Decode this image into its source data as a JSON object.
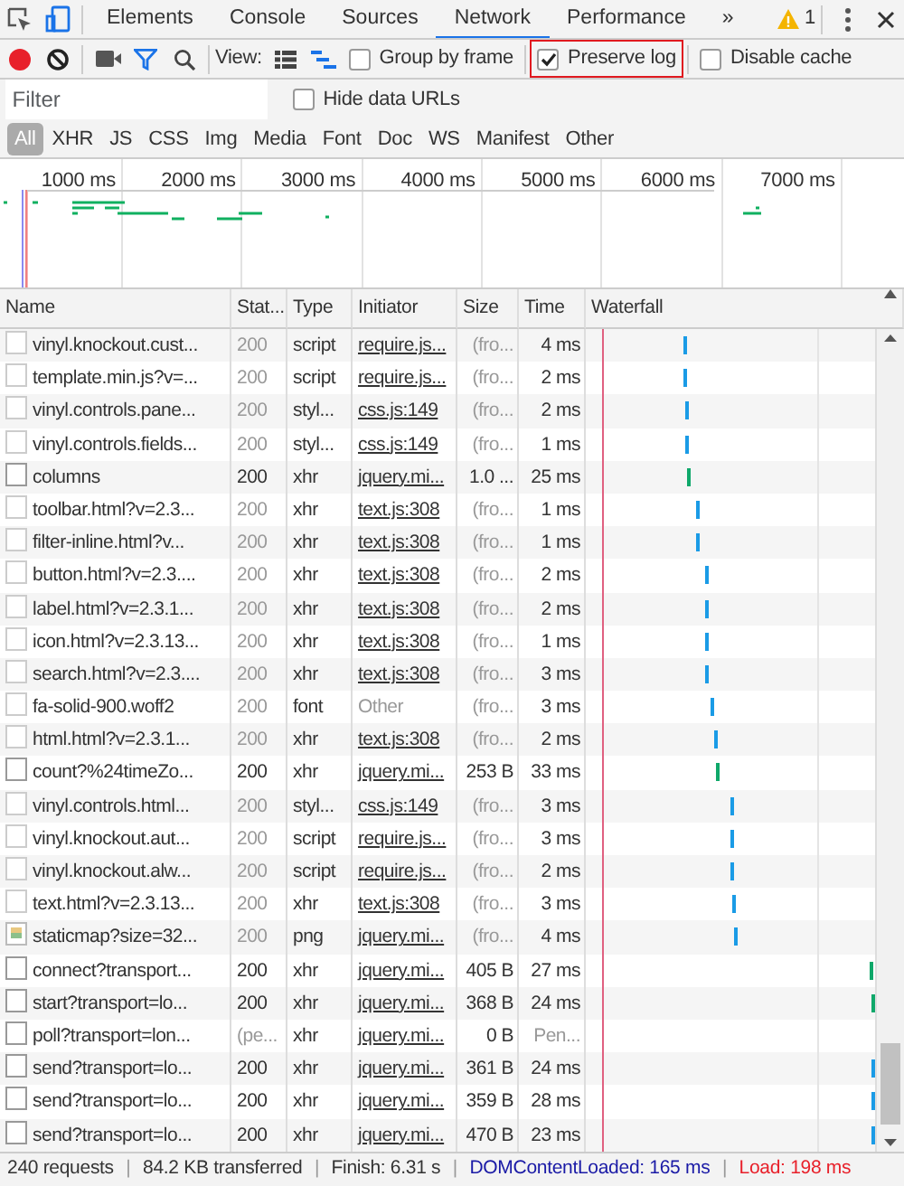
{
  "panel_tabs": [
    {
      "label": "Elements",
      "selected": false
    },
    {
      "label": "Console",
      "selected": false
    },
    {
      "label": "Sources",
      "selected": false
    },
    {
      "label": "Network",
      "selected": true
    },
    {
      "label": "Performance",
      "selected": false
    }
  ],
  "more_tabs": "»",
  "warning_count": "1",
  "toolbar": {
    "recording": true,
    "filter_on": true,
    "view_label": "View:",
    "large_rows": false,
    "checkboxes": [
      {
        "label": "Group by frame",
        "checked": false,
        "highlighted": false
      },
      {
        "label": "Preserve log",
        "checked": true,
        "highlighted": true
      },
      {
        "label": "Disable cache",
        "checked": false,
        "highlighted": false
      }
    ]
  },
  "filter": {
    "placeholder": "Filter",
    "hide_data_urls": {
      "label": "Hide data URLs",
      "checked": false
    }
  },
  "type_filters": [
    {
      "label": "All",
      "selected": true
    },
    {
      "label": "XHR",
      "selected": false
    },
    {
      "label": "JS",
      "selected": false
    },
    {
      "label": "CSS",
      "selected": false
    },
    {
      "label": "Img",
      "selected": false
    },
    {
      "label": "Media",
      "selected": false
    },
    {
      "label": "Font",
      "selected": false
    },
    {
      "label": "Doc",
      "selected": false
    },
    {
      "label": "WS",
      "selected": false
    },
    {
      "label": "Manifest",
      "selected": false
    },
    {
      "label": "Other",
      "selected": false
    }
  ],
  "overview_ticks": [
    "1000 ms",
    "2000 ms",
    "3000 ms",
    "4000 ms",
    "5000 ms",
    "6000 ms",
    "7000 ms"
  ],
  "table": {
    "columns": [
      "Name",
      "Stat...",
      "Type",
      "Initiator",
      "Size",
      "Time",
      "Waterfall"
    ],
    "rows": [
      {
        "kind": "cached",
        "name": "vinyl.knockout.cust...",
        "status": "200",
        "type": "script",
        "initiator": "require.js...",
        "initiator_link": true,
        "size": "(fro...",
        "time": "4 ms",
        "color": "#1a9be6"
      },
      {
        "kind": "cached",
        "name": "template.min.js?v=...",
        "status": "200",
        "type": "script",
        "initiator": "require.js...",
        "initiator_link": true,
        "size": "(fro...",
        "time": "2 ms",
        "color": "#1a9be6"
      },
      {
        "kind": "cached",
        "name": "vinyl.controls.pane...",
        "status": "200",
        "type": "styl...",
        "initiator": "css.js:149",
        "initiator_link": true,
        "size": "(fro...",
        "time": "2 ms",
        "color": "#1a9be6"
      },
      {
        "kind": "cached",
        "name": "vinyl.controls.fields...",
        "status": "200",
        "type": "styl...",
        "initiator": "css.js:149",
        "initiator_link": true,
        "size": "(fro...",
        "time": "1 ms",
        "color": "#1a9be6"
      },
      {
        "kind": "network",
        "name": "columns",
        "status": "200",
        "type": "xhr",
        "initiator": "jquery.mi...",
        "initiator_link": true,
        "size": "1.0 ...",
        "time": "25 ms",
        "color": "#0fa86a"
      },
      {
        "kind": "cached",
        "name": "toolbar.html?v=2.3...",
        "status": "200",
        "type": "xhr",
        "initiator": "text.js:308",
        "initiator_link": true,
        "size": "(fro...",
        "time": "1 ms",
        "color": "#1a9be6"
      },
      {
        "kind": "cached",
        "name": "filter-inline.html?v...",
        "status": "200",
        "type": "xhr",
        "initiator": "text.js:308",
        "initiator_link": true,
        "size": "(fro...",
        "time": "1 ms",
        "color": "#1a9be6"
      },
      {
        "kind": "cached",
        "name": "button.html?v=2.3....",
        "status": "200",
        "type": "xhr",
        "initiator": "text.js:308",
        "initiator_link": true,
        "size": "(fro...",
        "time": "2 ms",
        "color": "#1a9be6"
      },
      {
        "kind": "cached",
        "name": "label.html?v=2.3.1...",
        "status": "200",
        "type": "xhr",
        "initiator": "text.js:308",
        "initiator_link": true,
        "size": "(fro...",
        "time": "2 ms",
        "color": "#1a9be6"
      },
      {
        "kind": "cached",
        "name": "icon.html?v=2.3.13...",
        "status": "200",
        "type": "xhr",
        "initiator": "text.js:308",
        "initiator_link": true,
        "size": "(fro...",
        "time": "1 ms",
        "color": "#1a9be6"
      },
      {
        "kind": "cached",
        "name": "search.html?v=2.3....",
        "status": "200",
        "type": "xhr",
        "initiator": "text.js:308",
        "initiator_link": true,
        "size": "(fro...",
        "time": "3 ms",
        "color": "#1a9be6"
      },
      {
        "kind": "cached",
        "name": "fa-solid-900.woff2",
        "status": "200",
        "type": "font",
        "initiator": "Other",
        "initiator_link": false,
        "size": "(fro...",
        "time": "3 ms",
        "color": "#1a9be6"
      },
      {
        "kind": "cached",
        "name": "html.html?v=2.3.1...",
        "status": "200",
        "type": "xhr",
        "initiator": "text.js:308",
        "initiator_link": true,
        "size": "(fro...",
        "time": "2 ms",
        "color": "#1a9be6"
      },
      {
        "kind": "network",
        "name": "count?%24timeZo...",
        "status": "200",
        "type": "xhr",
        "initiator": "jquery.mi...",
        "initiator_link": true,
        "size": "253 B",
        "time": "33 ms",
        "color": "#0fa86a"
      },
      {
        "kind": "cached",
        "name": "vinyl.controls.html...",
        "status": "200",
        "type": "styl...",
        "initiator": "css.js:149",
        "initiator_link": true,
        "size": "(fro...",
        "time": "3 ms",
        "color": "#1a9be6"
      },
      {
        "kind": "cached",
        "name": "vinyl.knockout.aut...",
        "status": "200",
        "type": "script",
        "initiator": "require.js...",
        "initiator_link": true,
        "size": "(fro...",
        "time": "3 ms",
        "color": "#1a9be6"
      },
      {
        "kind": "cached",
        "name": "vinyl.knockout.alw...",
        "status": "200",
        "type": "script",
        "initiator": "require.js...",
        "initiator_link": true,
        "size": "(fro...",
        "time": "2 ms",
        "color": "#1a9be6"
      },
      {
        "kind": "cached",
        "name": "text.html?v=2.3.13...",
        "status": "200",
        "type": "xhr",
        "initiator": "text.js:308",
        "initiator_link": true,
        "size": "(fro...",
        "time": "3 ms",
        "color": "#1a9be6"
      },
      {
        "kind": "cached-image",
        "name": "staticmap?size=32...",
        "status": "200",
        "type": "png",
        "initiator": "jquery.mi...",
        "initiator_link": true,
        "size": "(fro...",
        "time": "4 ms",
        "color": "#1a9be6"
      },
      {
        "kind": "network",
        "name": "connect?transport...",
        "status": "200",
        "type": "xhr",
        "initiator": "jquery.mi...",
        "initiator_link": true,
        "size": "405 B",
        "time": "27 ms",
        "color": "#0fa86a"
      },
      {
        "kind": "network",
        "name": "start?transport=lo...",
        "status": "200",
        "type": "xhr",
        "initiator": "jquery.mi...",
        "initiator_link": true,
        "size": "368 B",
        "time": "24 ms",
        "color": "#0fa86a"
      },
      {
        "kind": "pending",
        "name": "poll?transport=lon...",
        "status": "(pe...",
        "type": "xhr",
        "initiator": "jquery.mi...",
        "initiator_link": true,
        "size": "0 B",
        "time": "Pen..."
      },
      {
        "kind": "network",
        "name": "send?transport=lo...",
        "status": "200",
        "type": "xhr",
        "initiator": "jquery.mi...",
        "initiator_link": true,
        "size": "361 B",
        "time": "24 ms",
        "color": "#1a9be6"
      },
      {
        "kind": "network",
        "name": "send?transport=lo...",
        "status": "200",
        "type": "xhr",
        "initiator": "jquery.mi...",
        "initiator_link": true,
        "size": "359 B",
        "time": "28 ms",
        "color": "#1a9be6"
      },
      {
        "kind": "network",
        "name": "send?transport=lo...",
        "status": "200",
        "type": "xhr",
        "initiator": "jquery.mi...",
        "initiator_link": true,
        "size": "470 B",
        "time": "23 ms",
        "color": "#1a9be6"
      }
    ]
  },
  "status_bar": [
    {
      "kind": "text",
      "text": "240 requests",
      "color": "#333333"
    },
    {
      "kind": "separator",
      "text": "|",
      "color": "#999999"
    },
    {
      "kind": "text",
      "text": "84.2 KB transferred",
      "color": "#333333"
    },
    {
      "kind": "separator",
      "text": "|",
      "color": "#999999"
    },
    {
      "kind": "text",
      "text": "Finish: 6.31 s",
      "color": "#333333"
    },
    {
      "kind": "separator",
      "text": "|",
      "color": "#999999"
    },
    {
      "kind": "text",
      "text": "DOMContentLoaded: 165 ms",
      "color": "#1a1aa6"
    },
    {
      "kind": "separator",
      "text": "|",
      "color": "#999999"
    },
    {
      "kind": "text",
      "text": "Load: 198 ms",
      "color": "#e8202a"
    }
  ]
}
